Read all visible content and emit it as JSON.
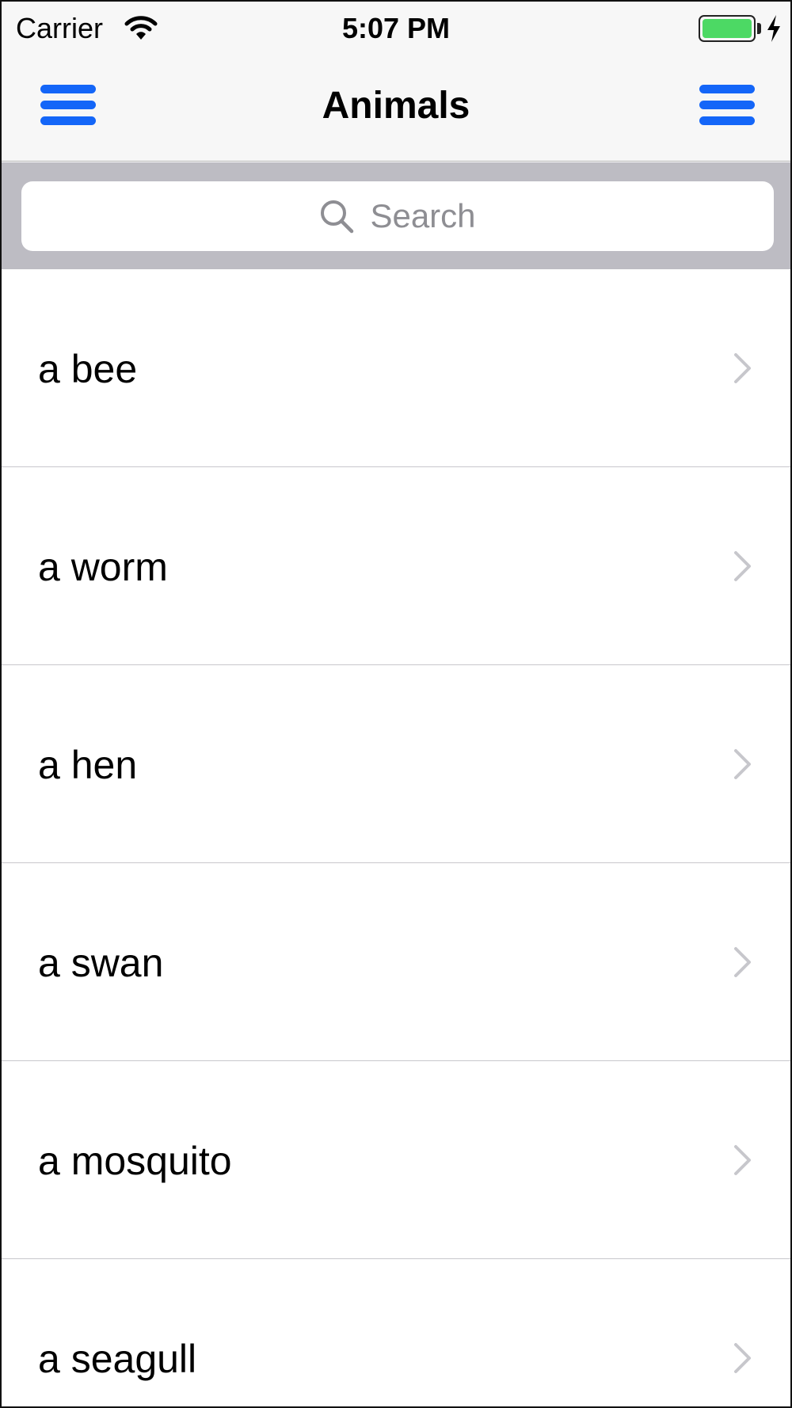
{
  "status_bar": {
    "carrier": "Carrier",
    "time": "5:07 PM",
    "battery_color": "#4cd964"
  },
  "nav": {
    "title": "Animals",
    "left_icon": "hamburger-menu-icon",
    "right_icon": "hamburger-menu-icon",
    "accent_color": "#1466f8"
  },
  "search": {
    "placeholder": "Search",
    "icon": "search-icon"
  },
  "list": {
    "items": [
      {
        "label": "a bee"
      },
      {
        "label": "a worm"
      },
      {
        "label": "a hen"
      },
      {
        "label": "a swan"
      },
      {
        "label": "a mosquito"
      },
      {
        "label": "a seagull"
      }
    ],
    "accessory_icon": "chevron-right-icon"
  }
}
